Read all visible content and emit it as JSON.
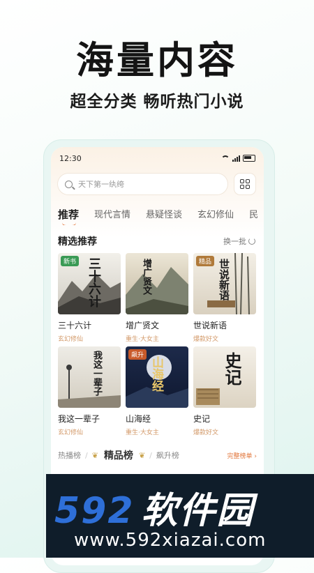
{
  "hero": {
    "title": "海量内容",
    "subtitle": "超全分类 畅听热门小说"
  },
  "status": {
    "time": "12:30"
  },
  "search": {
    "placeholder": "天下第一纨绔"
  },
  "tabs": [
    "推荐",
    "现代言情",
    "悬疑怪谈",
    "玄幻修仙",
    "民"
  ],
  "section": {
    "title": "精选推荐",
    "refresh": "换一批"
  },
  "books": [
    {
      "title": "三十六计",
      "tag": "玄幻修仙",
      "badge": "新书",
      "cover_text": "三十六计",
      "badge_color": "#3a9a55"
    },
    {
      "title": "增广贤文",
      "tag": "重生·大女主",
      "badge": "",
      "cover_text": "增广贤文",
      "badge_color": ""
    },
    {
      "title": "世说新语",
      "tag": "爆款好文",
      "badge": "精品",
      "cover_text": "世说新语",
      "badge_color": "#b07a3a"
    },
    {
      "title": "我这一辈子",
      "tag": "玄幻修仙",
      "badge": "",
      "cover_text": "我这一辈子",
      "badge_color": ""
    },
    {
      "title": "山海经",
      "tag": "重生·大女主",
      "badge": "飙升",
      "cover_text": "山海经",
      "badge_color": "#c85a2a"
    },
    {
      "title": "史记",
      "tag": "爆款好文",
      "badge": "",
      "cover_text": "史记",
      "badge_color": ""
    }
  ],
  "ranks": {
    "left": "热播榜",
    "main": "精品榜",
    "right": "飙升榜",
    "more": "完整榜单 ›"
  },
  "watermark": {
    "number": "592",
    "name": "软件园",
    "url": "www.592xiazai.com"
  },
  "colors": {
    "accent": "#e2763b",
    "tag": "#d39a6a"
  }
}
